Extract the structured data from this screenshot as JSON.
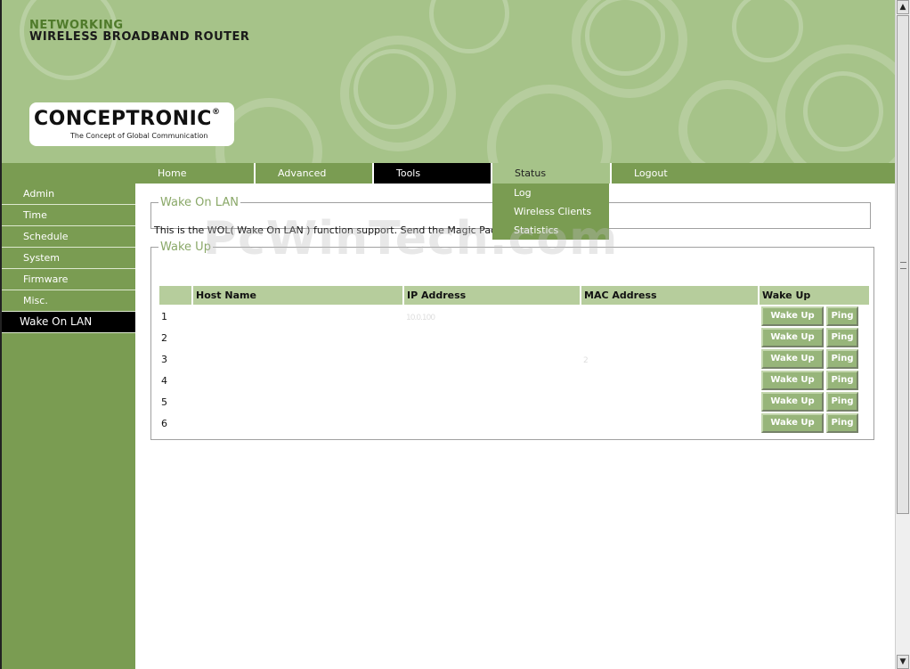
{
  "header": {
    "line1": "NETWORKING",
    "line2": "WIRELESS BROADBAND ROUTER",
    "logo_name": "CONCEPTRONIC",
    "logo_registered": "®",
    "logo_tagline": "The Concept of Global Communication"
  },
  "sidebar": {
    "items": [
      {
        "label": "Admin"
      },
      {
        "label": "Time"
      },
      {
        "label": "Schedule"
      },
      {
        "label": "System"
      },
      {
        "label": "Firmware"
      },
      {
        "label": "Misc."
      },
      {
        "label": "Wake On LAN"
      }
    ],
    "active": "Wake On LAN"
  },
  "nav": {
    "tabs": [
      {
        "label": "Home"
      },
      {
        "label": "Advanced"
      },
      {
        "label": "Tools"
      },
      {
        "label": "Status"
      },
      {
        "label": "Logout"
      }
    ],
    "status_menu": [
      {
        "label": "Log"
      },
      {
        "label": "Wireless Clients"
      },
      {
        "label": "Statistics"
      }
    ]
  },
  "wol": {
    "legend": "Wake On LAN",
    "description": "This is the WOL( Wake On LAN ) function support. Send the Magic Packet to the"
  },
  "wakeup": {
    "legend": "Wake Up",
    "headers": [
      "",
      "Host Name",
      "IP Address",
      "MAC Address",
      "Wake Up"
    ],
    "rows": [
      {
        "num": "1",
        "host": "",
        "ip": "10.0.100",
        "mac": ""
      },
      {
        "num": "2",
        "host": "",
        "ip": "",
        "mac": ""
      },
      {
        "num": "3",
        "host": "",
        "ip": "",
        "mac": "2"
      },
      {
        "num": "4",
        "host": "",
        "ip": "",
        "mac": ""
      },
      {
        "num": "5",
        "host": "",
        "ip": "",
        "mac": ""
      },
      {
        "num": "6",
        "host": "",
        "ip": "",
        "mac": ""
      }
    ],
    "wake_label": "Wake Up",
    "ping_label": "Ping"
  },
  "watermark": "PcWinTech.com",
  "colors": {
    "header_bg": "#a6c389",
    "nav_bg": "#7a9c52",
    "active_bg": "#000000",
    "table_header": "#b6cd9c",
    "button_bg": "#97b57a",
    "legend_text": "#8aa868"
  },
  "scrollbar": {
    "up_icon": "▲",
    "down_icon": "▼"
  }
}
